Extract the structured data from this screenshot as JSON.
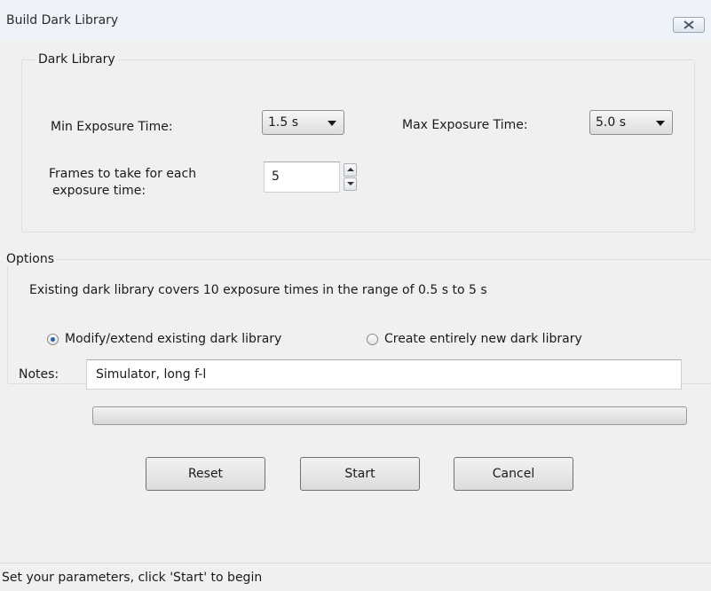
{
  "window": {
    "title": "Build Dark Library",
    "close_icon": "close-x-icon"
  },
  "dark_library": {
    "legend": "Dark Library",
    "min_exposure_label": "Min Exposure Time:",
    "min_exposure_value": "1.5 s",
    "max_exposure_label": "Max Exposure Time:",
    "max_exposure_value": "5.0 s",
    "frames_label_line1": "Frames to take for each",
    "frames_label_line2": "exposure time:",
    "frames_value": "5"
  },
  "options": {
    "legend": "Options",
    "summary": "Existing dark library covers 10 exposure times in the range of 0.5 s to 5 s",
    "radio_modify_label": "Modify/extend existing dark library",
    "radio_modify_checked": true,
    "radio_create_label": "Create entirely new dark library",
    "radio_create_checked": false
  },
  "notes": {
    "label": "Notes:",
    "value": "Simulator, long f-l"
  },
  "progress": {
    "fraction": 0
  },
  "buttons": {
    "reset": "Reset",
    "start": "Start",
    "cancel": "Cancel"
  },
  "status": {
    "text": "Set your parameters, click 'Start' to begin"
  }
}
